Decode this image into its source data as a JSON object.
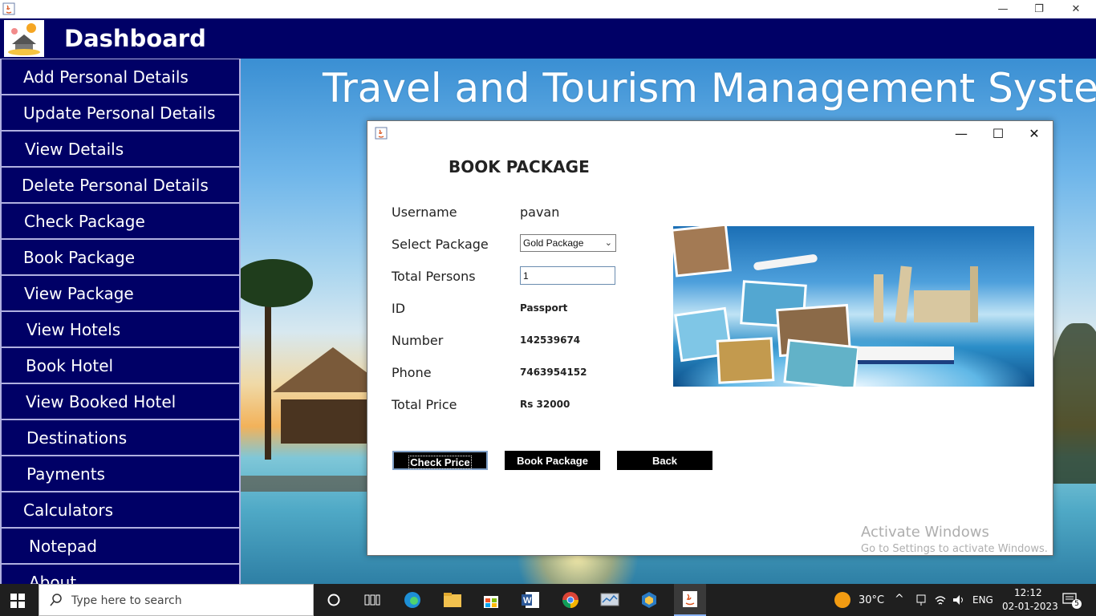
{
  "window": {
    "minimize_glyph": "—",
    "restore_glyph": "❐",
    "close_glyph": "✕"
  },
  "header": {
    "title": "Dashboard"
  },
  "sidebar": {
    "items": [
      {
        "label": "Add Personal Details"
      },
      {
        "label": "Update Personal Details"
      },
      {
        "label": "View Details"
      },
      {
        "label": "Delete Personal Details"
      },
      {
        "label": "Check Package"
      },
      {
        "label": "Book Package"
      },
      {
        "label": "View Package"
      },
      {
        "label": "View Hotels"
      },
      {
        "label": "Book Hotel"
      },
      {
        "label": "View Booked Hotel"
      },
      {
        "label": "Destinations"
      },
      {
        "label": "Payments"
      },
      {
        "label": "Calculators"
      },
      {
        "label": "Notepad"
      },
      {
        "label": "About"
      }
    ]
  },
  "main": {
    "app_title": "Travel and Tourism Management System"
  },
  "dialog": {
    "heading": "BOOK PACKAGE",
    "controls": {
      "minimize": "—",
      "maximize": "☐",
      "close": "✕"
    },
    "fields": {
      "username_label": "Username",
      "username_value": "pavan",
      "package_label": "Select Package",
      "package_selected": "Gold Package",
      "persons_label": "Total Persons",
      "persons_value": "1",
      "id_label": "ID",
      "id_value": "Passport",
      "number_label": "Number",
      "number_value": "142539674",
      "phone_label": "Phone",
      "phone_value": "7463954152",
      "price_label": "Total Price",
      "price_value": "Rs 32000"
    },
    "buttons": {
      "check_price": "Check Price",
      "book_package": "Book Package",
      "back": "Back"
    }
  },
  "watermark": {
    "line1": "Activate Windows",
    "line2": "Go to Settings to activate Windows."
  },
  "taskbar": {
    "search_placeholder": "Type here to search",
    "weather": "30°C",
    "language": "ENG",
    "time": "12:12",
    "date": "02-01-2023",
    "notification_count": "5"
  },
  "colors": {
    "sidebar_bg": "#000066",
    "header_bg": "#000066",
    "button_bg": "#000000"
  }
}
